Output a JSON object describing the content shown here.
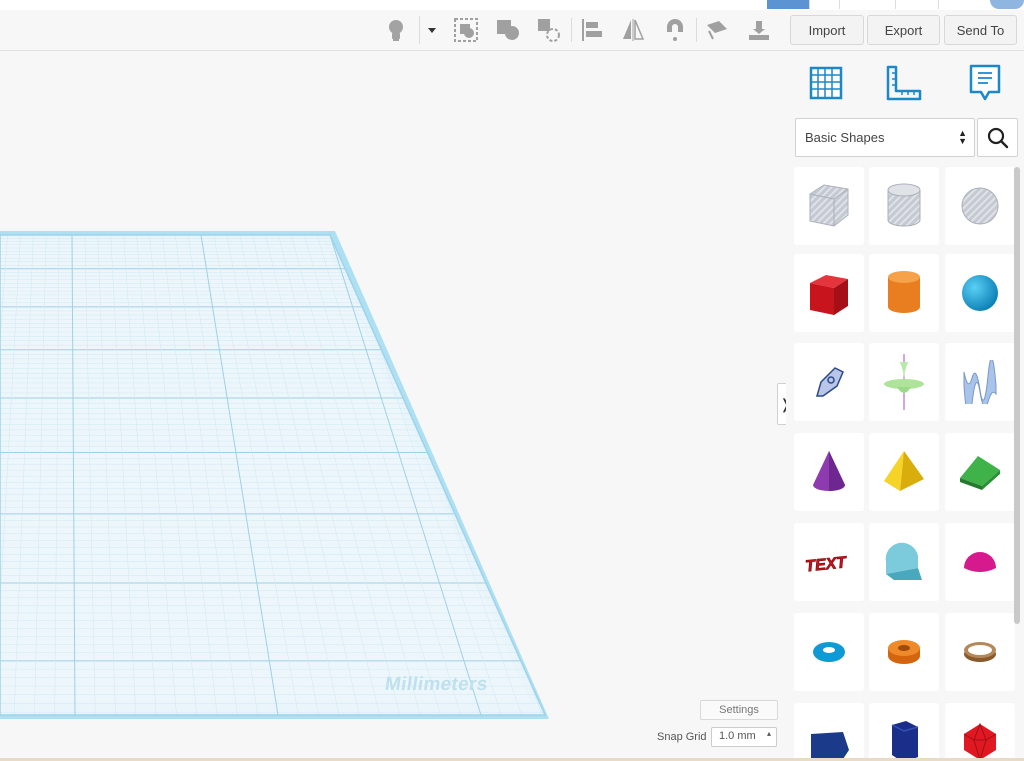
{
  "toolbar": {
    "icons": [
      "lightbulb-icon",
      "dropdown-icon",
      "group-icon",
      "ungroup-icon",
      "hole-icon",
      "align-icon",
      "mirror-icon",
      "cruise-icon",
      "notes-icon",
      "workplane-drop-icon"
    ],
    "import_label": "Import",
    "export_label": "Export",
    "send_to_label": "Send To"
  },
  "panel": {
    "view_icons": [
      "workplane-grid-icon",
      "ruler-icon",
      "notes-icon"
    ],
    "library": {
      "selected": "Basic Shapes"
    },
    "shapes": [
      [
        "box-hole",
        "cylinder-hole",
        "sphere-hole"
      ],
      [
        "box",
        "cylinder",
        "sphere"
      ],
      [
        "scribble",
        "shape-generator",
        "wavy-text"
      ],
      [
        "cone",
        "pyramid",
        "wedge"
      ],
      [
        "text",
        "half-cylinder",
        "half-sphere"
      ],
      [
        "torus",
        "tube",
        "ring"
      ],
      [
        "polygon",
        "polyhedron",
        "icosahedron"
      ]
    ],
    "scroll_fraction": 0.77
  },
  "workplane": {
    "units_label": "Millimeters",
    "settings_label": "Settings",
    "snap_grid_label": "Snap Grid",
    "snap_grid_value": "1.0 mm",
    "snap_arrow": "▴",
    "collapse_glyph": "❭"
  },
  "colors": {
    "grid_fill": "#e9f5fb",
    "grid_line": "#b7dced",
    "grid_border": "#aee0f3",
    "accent_blue": "#1c88c7",
    "toolbar_icon": "#9a9a9a",
    "top_tab_blue": "#5b93d3"
  }
}
